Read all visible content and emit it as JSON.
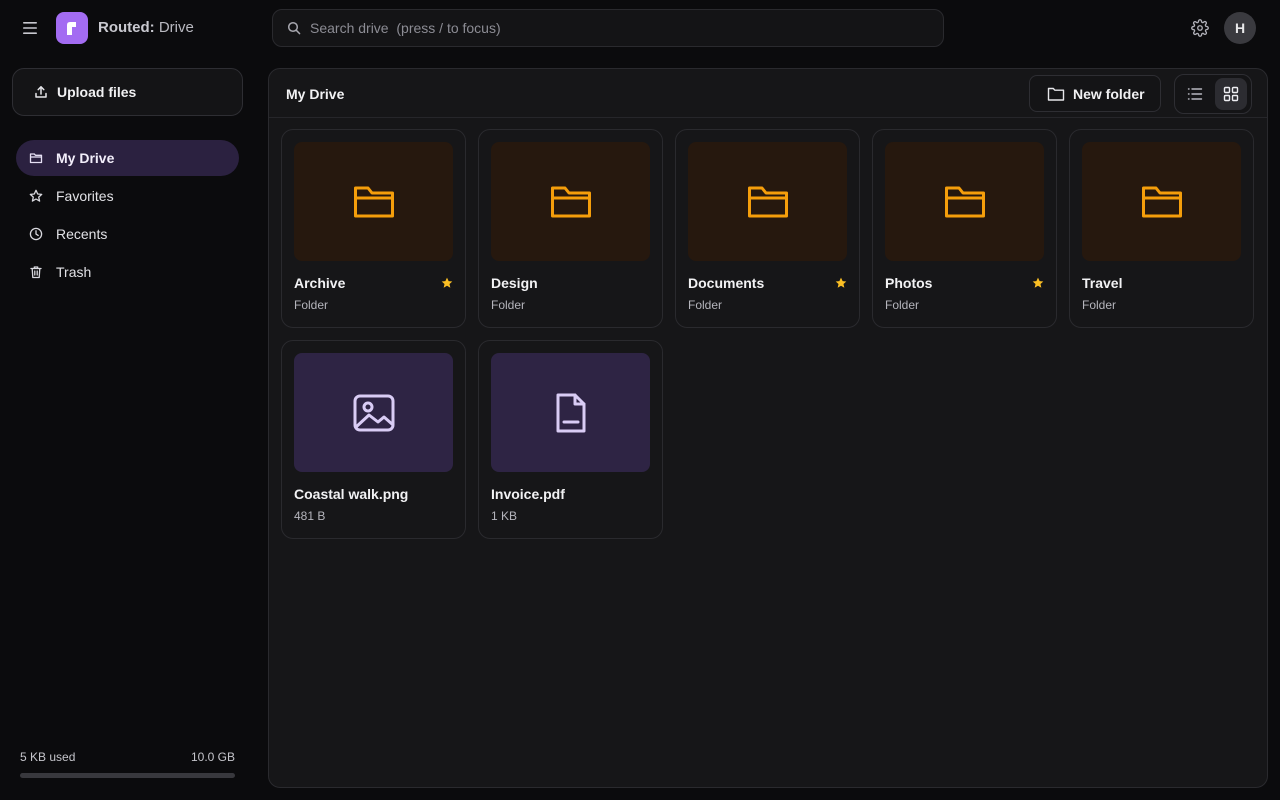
{
  "app": {
    "brand_bold": "Routed:",
    "brand_rest": " Drive",
    "logo_letter": "r",
    "accent": "#a36cf2"
  },
  "search": {
    "placeholder": "Search drive  (press / to focus)",
    "value": ""
  },
  "user": {
    "avatar_initial": "H"
  },
  "sidebar": {
    "upload_label": "Upload files",
    "items": [
      {
        "label": "My Drive",
        "icon": "folder-icon",
        "active": true
      },
      {
        "label": "Favorites",
        "icon": "star-icon",
        "active": false
      },
      {
        "label": "Recents",
        "icon": "clock-icon",
        "active": false
      },
      {
        "label": "Trash",
        "icon": "trash-icon",
        "active": false
      }
    ],
    "storage": {
      "used_label": "5 KB used",
      "total_label": "10.0 GB",
      "used_fraction": 5e-07
    }
  },
  "main": {
    "title": "My Drive",
    "new_folder_label": "New folder",
    "view_mode": "grid",
    "items": [
      {
        "name": "Archive",
        "meta": "Folder",
        "kind": "folder",
        "starred": true
      },
      {
        "name": "Design",
        "meta": "Folder",
        "kind": "folder",
        "starred": false
      },
      {
        "name": "Documents",
        "meta": "Folder",
        "kind": "folder",
        "starred": true
      },
      {
        "name": "Photos",
        "meta": "Folder",
        "kind": "folder",
        "starred": true
      },
      {
        "name": "Travel",
        "meta": "Folder",
        "kind": "folder",
        "starred": false
      },
      {
        "name": "Coastal walk.png",
        "meta": "481 B",
        "kind": "image",
        "starred": false
      },
      {
        "name": "Invoice.pdf",
        "meta": "1 KB",
        "kind": "document",
        "starred": false
      }
    ]
  },
  "colors": {
    "folder": "#f59e0b",
    "file_icon": "#d9ccf5",
    "star": "#fbbf24"
  }
}
